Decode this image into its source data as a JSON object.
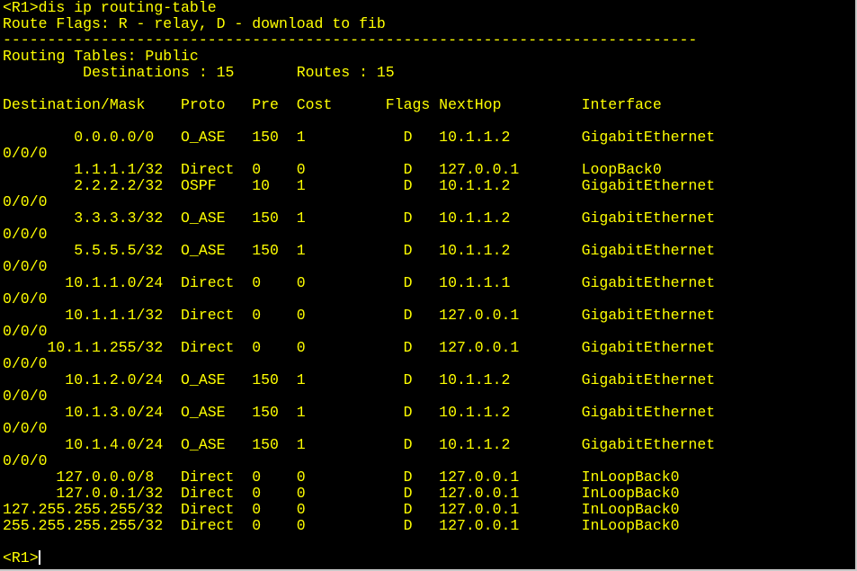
{
  "terminal": {
    "lines": [
      "<R1>dis ip routing-table",
      "Route Flags: R - relay, D - download to fib",
      "------------------------------------------------------------------------------",
      "Routing Tables: Public",
      "         Destinations : 15       Routes : 15",
      "",
      "Destination/Mask    Proto   Pre  Cost      Flags NextHop         Interface",
      "",
      "        0.0.0.0/0   O_ASE   150  1           D   10.1.1.2        GigabitEthernet",
      "0/0/0",
      "        1.1.1.1/32  Direct  0    0           D   127.0.0.1       LoopBack0",
      "        2.2.2.2/32  OSPF    10   1           D   10.1.1.2        GigabitEthernet",
      "0/0/0",
      "        3.3.3.3/32  O_ASE   150  1           D   10.1.1.2        GigabitEthernet",
      "0/0/0",
      "        5.5.5.5/32  O_ASE   150  1           D   10.1.1.2        GigabitEthernet",
      "0/0/0",
      "       10.1.1.0/24  Direct  0    0           D   10.1.1.1        GigabitEthernet",
      "0/0/0",
      "       10.1.1.1/32  Direct  0    0           D   127.0.0.1       GigabitEthernet",
      "0/0/0",
      "     10.1.1.255/32  Direct  0    0           D   127.0.0.1       GigabitEthernet",
      "0/0/0",
      "       10.1.2.0/24  O_ASE   150  1           D   10.1.1.2        GigabitEthernet",
      "0/0/0",
      "       10.1.3.0/24  O_ASE   150  1           D   10.1.1.2        GigabitEthernet",
      "0/0/0",
      "       10.1.4.0/24  O_ASE   150  1           D   10.1.1.2        GigabitEthernet",
      "0/0/0",
      "      127.0.0.0/8   Direct  0    0           D   127.0.0.1       InLoopBack0",
      "      127.0.0.1/32  Direct  0    0           D   127.0.0.1       InLoopBack0",
      "127.255.255.255/32  Direct  0    0           D   127.0.0.1       InLoopBack0",
      "255.255.255.255/32  Direct  0    0           D   127.0.0.1       InLoopBack0",
      ""
    ],
    "prompt": "<R1>",
    "colors": {
      "background": "#000000",
      "text": "#ffff00",
      "cursor": "#ffffff"
    }
  }
}
